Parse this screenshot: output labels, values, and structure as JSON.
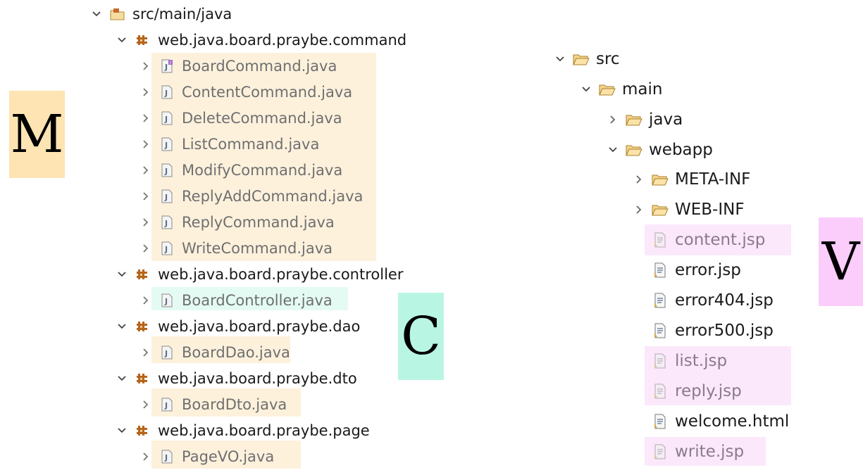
{
  "letters": {
    "m": "M",
    "c": "C",
    "v": "V"
  },
  "left_tree": {
    "root": "src/main/java",
    "packages": [
      {
        "name": "web.java.board.praybe.command",
        "files": [
          "BoardCommand.java",
          "ContentCommand.java",
          "DeleteCommand.java",
          "ListCommand.java",
          "ModifyCommand.java",
          "ReplyAddCommand.java",
          "ReplyCommand.java",
          "WriteCommand.java"
        ]
      },
      {
        "name": "web.java.board.praybe.controller",
        "files": [
          "BoardController.java"
        ]
      },
      {
        "name": "web.java.board.praybe.dao",
        "files": [
          "BoardDao.java"
        ]
      },
      {
        "name": "web.java.board.praybe.dto",
        "files": [
          "BoardDto.java"
        ]
      },
      {
        "name": "web.java.board.praybe.page",
        "files": [
          "PageVO.java"
        ]
      }
    ]
  },
  "right_tree": {
    "src": "src",
    "main": "main",
    "java": "java",
    "webapp": "webapp",
    "meta_inf": "META-INF",
    "web_inf": "WEB-INF",
    "files": [
      "content.jsp",
      "error.jsp",
      "error404.jsp",
      "error500.jsp",
      "list.jsp",
      "reply.jsp",
      "welcome.html",
      "write.jsp"
    ]
  },
  "colors": {
    "model_highlight": "#fdf1dc",
    "controller_highlight": "#e4fbf3",
    "view_highlight": "#fbe9fb",
    "model_badge": "#fde4b2",
    "controller_badge": "#b9f5e3",
    "view_badge": "#fbcdfb"
  }
}
